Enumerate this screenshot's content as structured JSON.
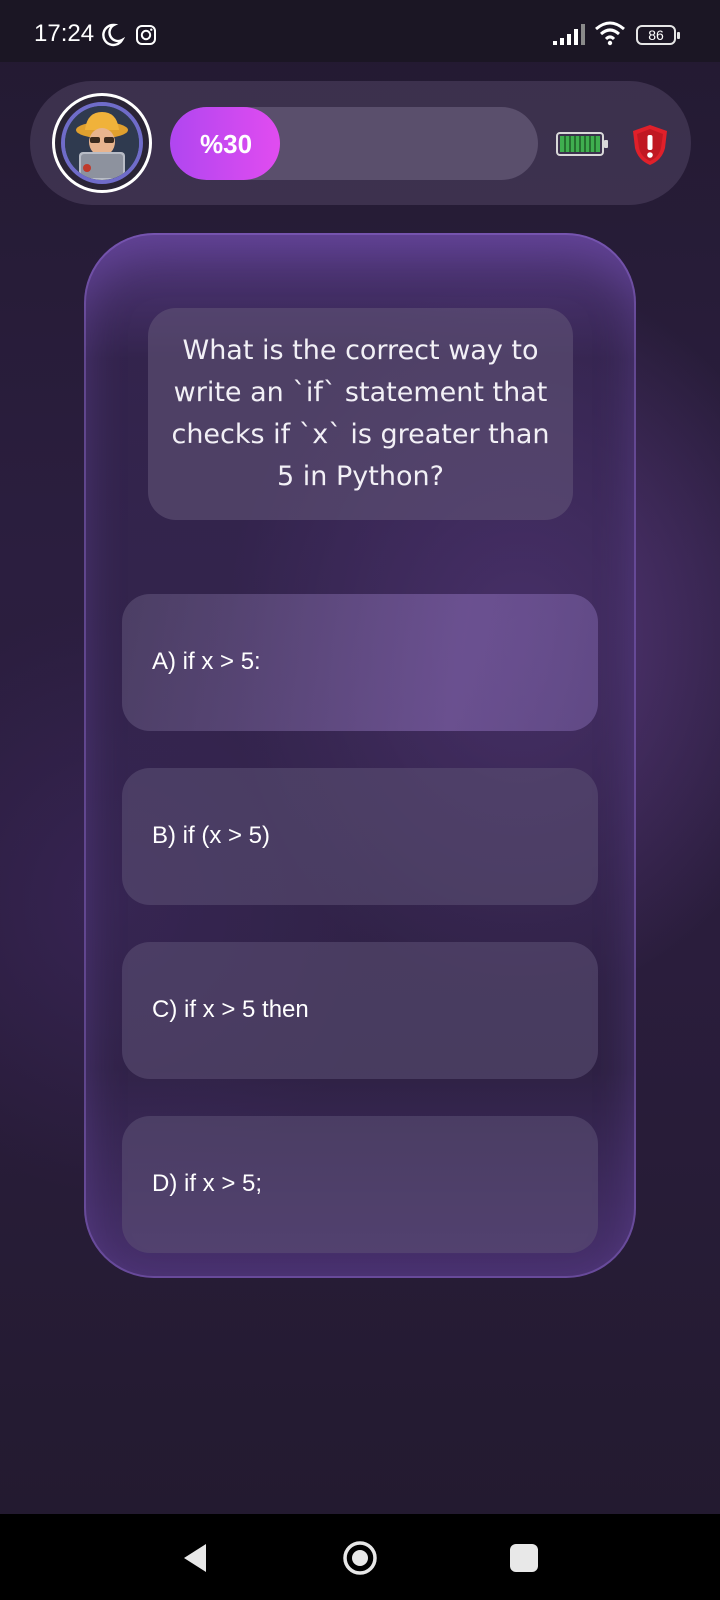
{
  "status_bar": {
    "time": "17:24",
    "battery_level": "86",
    "icons": [
      "moon-icon",
      "instagram-icon",
      "signal-icon",
      "wifi-icon",
      "battery-icon"
    ]
  },
  "header": {
    "progress_label": "%30",
    "progress_fraction": 0.3,
    "icons": [
      "avatar",
      "energy-battery-icon",
      "shield-alert-icon"
    ],
    "colors": {
      "progress_fill": "#b046f0",
      "track": "#5a4f6c",
      "shield": "#e0202a",
      "energy": "#3fae4f"
    }
  },
  "question": {
    "text": "What is the correct way to write an `if` statement that checks if `x` is greater than 5 in Python?"
  },
  "answers": [
    {
      "label": "A) if x > 5:"
    },
    {
      "label": "B) if (x > 5)"
    },
    {
      "label": "C) if x > 5 then"
    },
    {
      "label": "D) if x > 5;"
    }
  ],
  "nav_bar": {
    "icons": [
      "back-icon",
      "home-icon",
      "recents-icon"
    ]
  }
}
